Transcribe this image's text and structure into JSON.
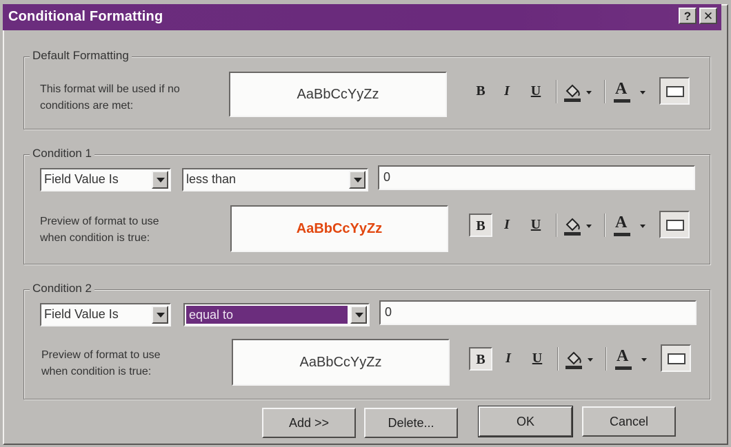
{
  "dialog": {
    "title": "Conditional Formatting",
    "help_glyph": "?",
    "close_glyph": "✕"
  },
  "default_formatting": {
    "group_label": "Default Formatting",
    "description_line1": "This format will be used if no",
    "description_line2": "conditions are met:",
    "preview_text": "AaBbCcYyZz"
  },
  "conditions": [
    {
      "group_label": "Condition 1",
      "field_type": "Field Value Is",
      "operator": "less than",
      "value": "0",
      "preview_label_line1": "Preview of format to use",
      "preview_label_line2": "when condition is true:",
      "preview_text": "AaBbCcYyZz",
      "preview_color": "#e2470f",
      "bold_pressed": true
    },
    {
      "group_label": "Condition 2",
      "field_type": "Field Value Is",
      "operator": "equal to",
      "operator_selected": true,
      "value": "0",
      "preview_label_line1": "Preview of format to use",
      "preview_label_line2": "when condition is true:",
      "preview_text": "AaBbCcYyZz",
      "bold_pressed": true
    }
  ],
  "toolbar": {
    "bold": "B",
    "italic": "I",
    "underline": "U",
    "font_color_glyph": "A",
    "fill_icon": "paint-bucket-icon",
    "enabled_icon": "enable-toggle-icon"
  },
  "buttons": {
    "add": "Add >>",
    "delete": "Delete...",
    "ok": "OK",
    "cancel": "Cancel"
  },
  "colors": {
    "titlebar": "#6b2d7d",
    "selection": "#6b2d7d",
    "font_color_underline": "#2d2d2d"
  }
}
